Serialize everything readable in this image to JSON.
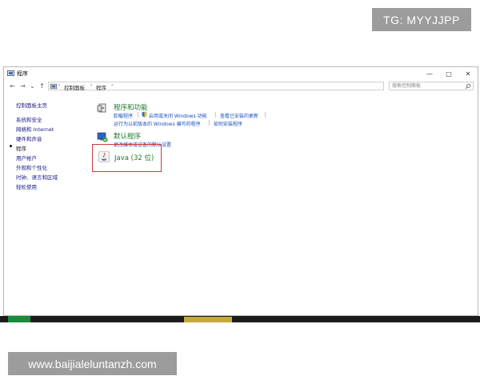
{
  "overlay": {
    "tg_badge": "TG: MYYJJPP",
    "watermark": "www.baijialeluntanzh.com"
  },
  "window": {
    "title": "程序",
    "controls": {
      "minimize": "—",
      "maximize": "□",
      "close": "✕"
    }
  },
  "address": {
    "back": "←",
    "forward": "→",
    "history": "⌄",
    "up": "↑",
    "crumbs": [
      "控制面板",
      "程序"
    ],
    "crumb_sep": "›",
    "search_placeholder": "搜索控制面板"
  },
  "sidebar": {
    "items": [
      {
        "label": "控制面板主页",
        "active": false
      },
      {
        "label": "系统和安全",
        "active": false
      },
      {
        "label": "网络和 Internet",
        "active": false
      },
      {
        "label": "硬件和声音",
        "active": false
      },
      {
        "label": "程序",
        "active": true
      },
      {
        "label": "用户帐户",
        "active": false
      },
      {
        "label": "外观和个性化",
        "active": false
      },
      {
        "label": "时钟、语言和区域",
        "active": false
      },
      {
        "label": "轻松使用",
        "active": false
      }
    ]
  },
  "categories": {
    "programs_features": {
      "title": "程序和功能",
      "links": [
        "卸载程序",
        "启用或关闭 Windows 功能",
        "查看已安装的更新",
        "运行为以前版本的 Windows 编写的程序",
        "如何安装程序"
      ]
    },
    "default_programs": {
      "title": "默认程序",
      "links": [
        "更改媒体或设备的默认设置"
      ]
    },
    "java": {
      "title": "Java (32 位)"
    }
  },
  "colors": {
    "category_title": "#1e7d2a",
    "link": "#1a4ec2",
    "highlight": "#d23a3a"
  }
}
